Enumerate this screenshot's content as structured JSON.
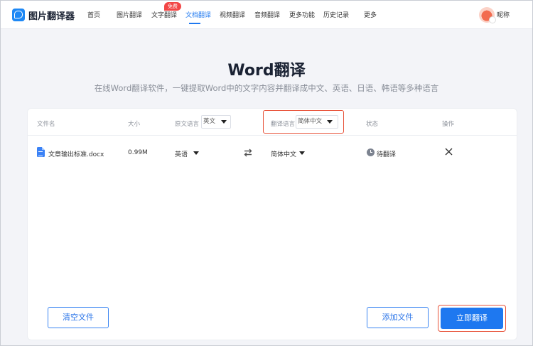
{
  "header": {
    "app_name": "图片翻译器",
    "nav": [
      "首页",
      "图片翻译",
      "文字翻译",
      "文档翻译",
      "视频翻译",
      "音频翻译",
      "更多功能",
      "历史记录",
      "更多"
    ],
    "active_nav": "文档翻译",
    "badge": "免费",
    "nickname": "昵称"
  },
  "hero": {
    "title": "Word翻译",
    "subtitle": "在线Word翻译软件，一键提取Word中的文字内容并翻译成中文、英语、日语、韩语等多种语言"
  },
  "table": {
    "headers": {
      "filename": "文件名",
      "size": "大小",
      "source_lang": "原文语言",
      "target_lang": "翻译语言",
      "status": "状态",
      "action": "操作"
    },
    "source_lang_default": "英文",
    "target_lang_default": "简体中文",
    "rows": [
      {
        "filename": "文章输出标准.docx",
        "size": "0.99M",
        "source_lang": "英语",
        "target_lang": "简体中文",
        "status": "待翻译"
      }
    ]
  },
  "buttons": {
    "clear": "清空文件",
    "add": "添加文件",
    "translate": "立即翻译"
  },
  "colors": {
    "accent": "#1e78f0",
    "highlight": "#e8533a",
    "badge": "#f24646"
  }
}
